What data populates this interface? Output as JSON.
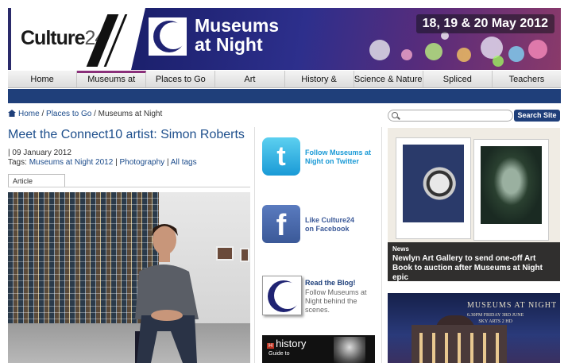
{
  "banner": {
    "logo": "Culture24",
    "logo_main": "Culture",
    "logo_num": "24",
    "title_line1": "Museums",
    "title_line2": "at Night",
    "dates": "18, 19 & 20 May 2012"
  },
  "nav": {
    "items": [
      "Home",
      "Museums at Night",
      "Places to Go",
      "Art",
      "History & Heritage",
      "Science & Nature",
      "Spliced",
      "Teachers"
    ],
    "active": "Museums at Night"
  },
  "breadcrumb": {
    "home": "Home",
    "sep": " / ",
    "places": "Places to Go",
    "current": "Museums at Night"
  },
  "article": {
    "title": "Meet the Connect10 artist: Simon Roberts",
    "date": "| 09 January 2012",
    "tags_label": "Tags:",
    "tags": [
      "Museums at Night 2012",
      "Photography",
      "All tags"
    ],
    "tab": "Article"
  },
  "social": {
    "twitter": "Follow Museums at Night on Twitter",
    "facebook": "Like Culture24 on Facebook",
    "blog_title": "Read the Blog!",
    "blog_text": "Follow Museums at Night behind the scenes.",
    "history_brand": "history",
    "history_text": "Guide to"
  },
  "search": {
    "placeholder": "",
    "button": "Search Site"
  },
  "news": {
    "tag": "News",
    "headline": "Newlyn Art Gallery to send one-off Art Book to auction after Museums at Night epic"
  },
  "promo": {
    "title": "MUSEUMS AT NIGHT",
    "line1": "6.30PM FRIDAY 3RD JUNE",
    "line2": "SKY ARTS 2 HD"
  },
  "colors": {
    "navy": "#1f3f7a",
    "link": "#1e4f8c",
    "accent": "#8a2f7a"
  }
}
